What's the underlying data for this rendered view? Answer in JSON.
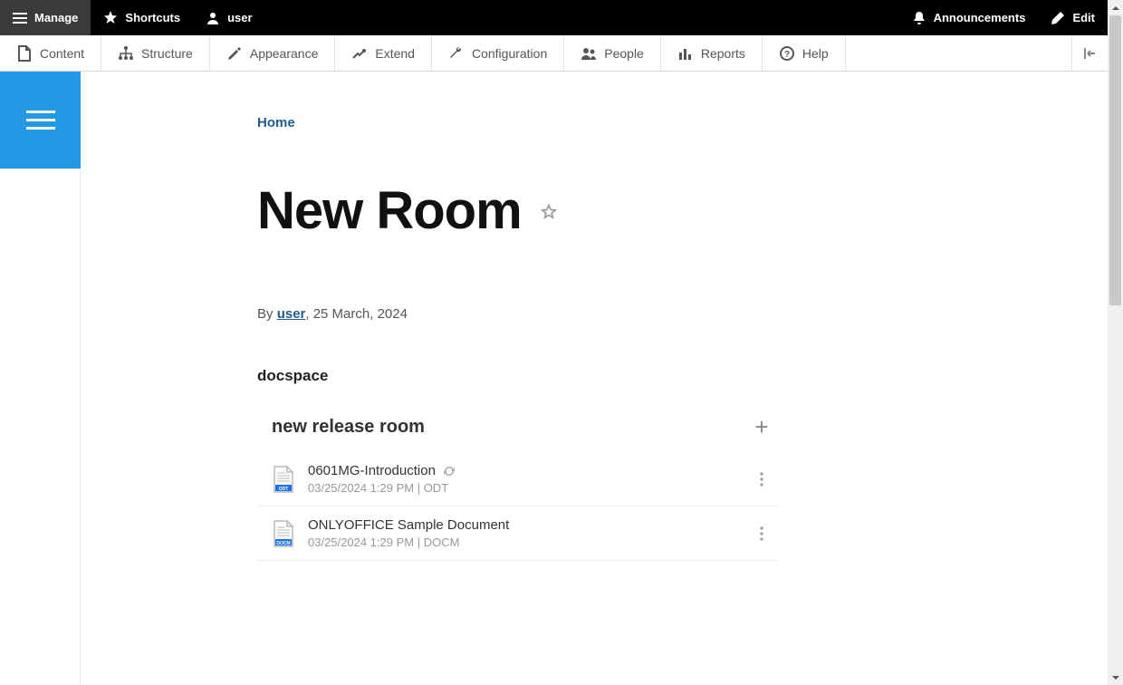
{
  "topbar": {
    "manage": "Manage",
    "shortcuts": "Shortcuts",
    "user": "user",
    "announcements": "Announcements",
    "edit": "Edit"
  },
  "adminmenu": {
    "content": "Content",
    "structure": "Structure",
    "appearance": "Appearance",
    "extend": "Extend",
    "configuration": "Configuration",
    "people": "People",
    "reports": "Reports",
    "help": "Help"
  },
  "breadcrumb": {
    "home": "Home"
  },
  "page": {
    "title": "New Room",
    "by_prefix": "By ",
    "author": "user",
    "by_suffix": ", 25 March, 2024",
    "section_label": "docspace"
  },
  "docspace": {
    "room_name": "new release room",
    "files": [
      {
        "name": "0601MG-Introduction",
        "meta": "03/25/2024 1:29 PM | ODT",
        "ext_label": "ODT",
        "ext_color": "#1a73e8",
        "show_refresh": true
      },
      {
        "name": "ONLYOFFICE Sample Document",
        "meta": "03/25/2024 1:29 PM | DOCM",
        "ext_label": "DOCM",
        "ext_color": "#1a73e8",
        "show_refresh": false
      }
    ]
  }
}
